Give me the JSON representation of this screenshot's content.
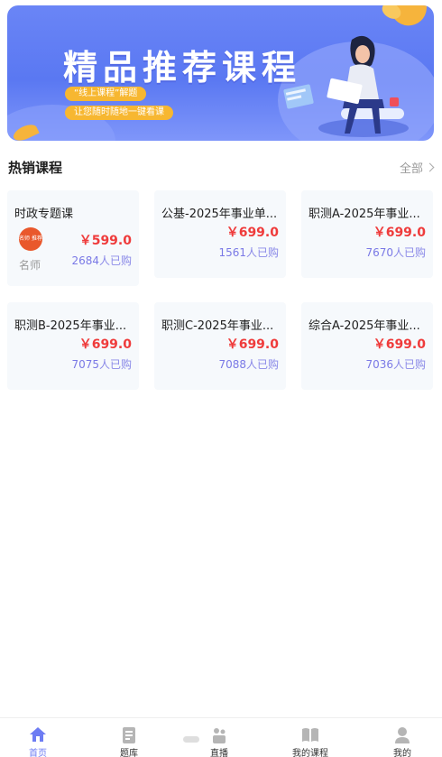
{
  "banner": {
    "title": "精品推荐课程",
    "tag1": "“线上课程”解题",
    "tag2": "让您随时随地一键看课"
  },
  "section": {
    "title": "热销课程",
    "more": "全部"
  },
  "courses": [
    {
      "name": "时政专题课",
      "price": "￥599.0",
      "sold_count": "2684",
      "sold_suffix": "人已购",
      "teacher_label": "名师",
      "avatar_text": "名师 推荐"
    },
    {
      "name": "公基-2025年事业单...",
      "price": "￥699.0",
      "sold_count": "1561",
      "sold_suffix": "人已购"
    },
    {
      "name": "职测A-2025年事业...",
      "price": "￥699.0",
      "sold_count": "7670",
      "sold_suffix": "人已购"
    },
    {
      "name": "职测B-2025年事业...",
      "price": "￥699.0",
      "sold_count": "7075",
      "sold_suffix": "人已购"
    },
    {
      "name": "职测C-2025年事业...",
      "price": "￥699.0",
      "sold_count": "7088",
      "sold_suffix": "人已购"
    },
    {
      "name": "综合A-2025年事业...",
      "price": "￥699.0",
      "sold_count": "7036",
      "sold_suffix": "人已购"
    }
  ],
  "tabbar": {
    "items": [
      {
        "label": "首页",
        "icon": "home-icon",
        "active": true
      },
      {
        "label": "题库",
        "icon": "question-bank-icon",
        "active": false
      },
      {
        "label": "直播",
        "icon": "live-icon",
        "active": false
      },
      {
        "label": "我的课程",
        "icon": "my-courses-icon",
        "active": false
      },
      {
        "label": "我的",
        "icon": "profile-icon",
        "active": false
      }
    ]
  },
  "colors": {
    "accent": "#6d7cf3",
    "price": "#ef3b3b",
    "sold": "#8a89e8",
    "banner": "#5a78f2"
  }
}
